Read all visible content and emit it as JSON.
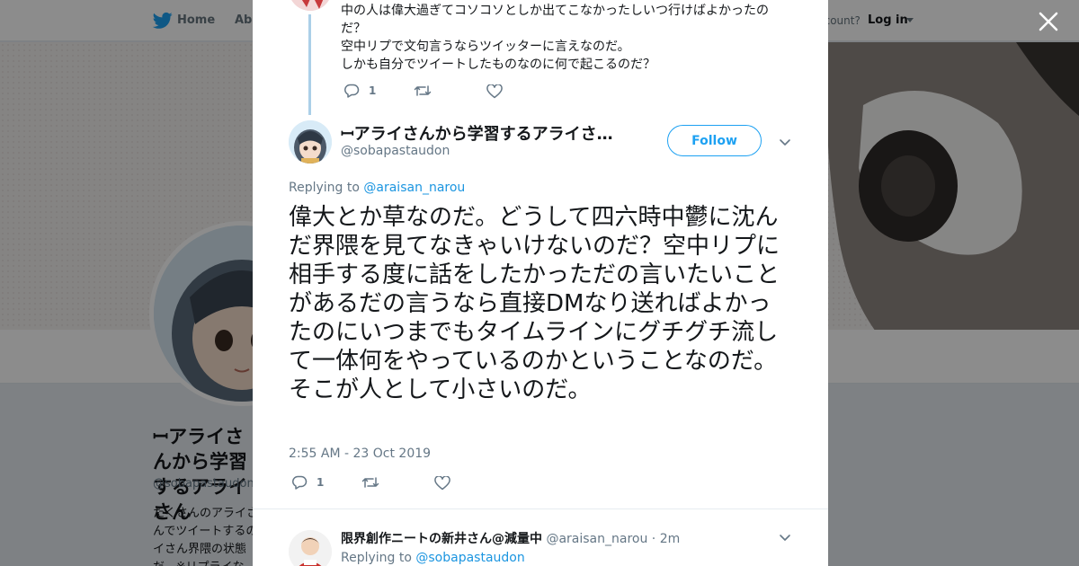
{
  "nav": {
    "home": "Home",
    "about": "Abo",
    "account_prompt": "ccount?",
    "login": "Log in"
  },
  "profile_bg": {
    "name": "ꟷアライさんから学習するアライさん",
    "handle": "@sobapastaudon",
    "bio": "たくさんのアライさんでツイートするのイさん界隈の状態だ。※リプライな"
  },
  "previous_tweet": {
    "text_lines": [
      "中の人は偉大過ぎてコソコソとしか出てこなかったしいつ行けばよかったの",
      "だ？",
      "空中リプで文句言うならツイッターに言えなのだ。",
      "しかも自分でツイートしたものなのに何で起こるのだ？"
    ],
    "reply_count": "1"
  },
  "main_tweet": {
    "name": "ꟷアライさんから学習するアライさん…",
    "handle": "@sobapastaudon",
    "follow_label": "Follow",
    "replying_prefix": "Replying to",
    "replying_to": "@araisan_narou",
    "text": "偉大とか草なのだ。どうして四六時中鬱に沈んだ界隈を見てなきゃいけないのだ？空中リプに相手する度に話をしたかっただの言いたいことがあるだの言うなら直接DMなり送ればよかったのにいつまでもタイムラインにグチグチ流して一体何をやっているのかということなのだ。そこが人として小さいのだ。",
    "timestamp": "2:55 AM - 23 Oct 2019",
    "reply_count": "1"
  },
  "reply_tweet": {
    "name": "限界創作ニートの新井さん@減量中",
    "handle": "@araisan_narou",
    "separator": "·",
    "time": "2m",
    "replying_prefix": "Replying to",
    "replying_to": "@sobapastaudon"
  },
  "colors": {
    "accent": "#1da1f2",
    "link": "#1b95e0",
    "secondary_text": "#657786",
    "thread_line": "#abcfe8"
  }
}
